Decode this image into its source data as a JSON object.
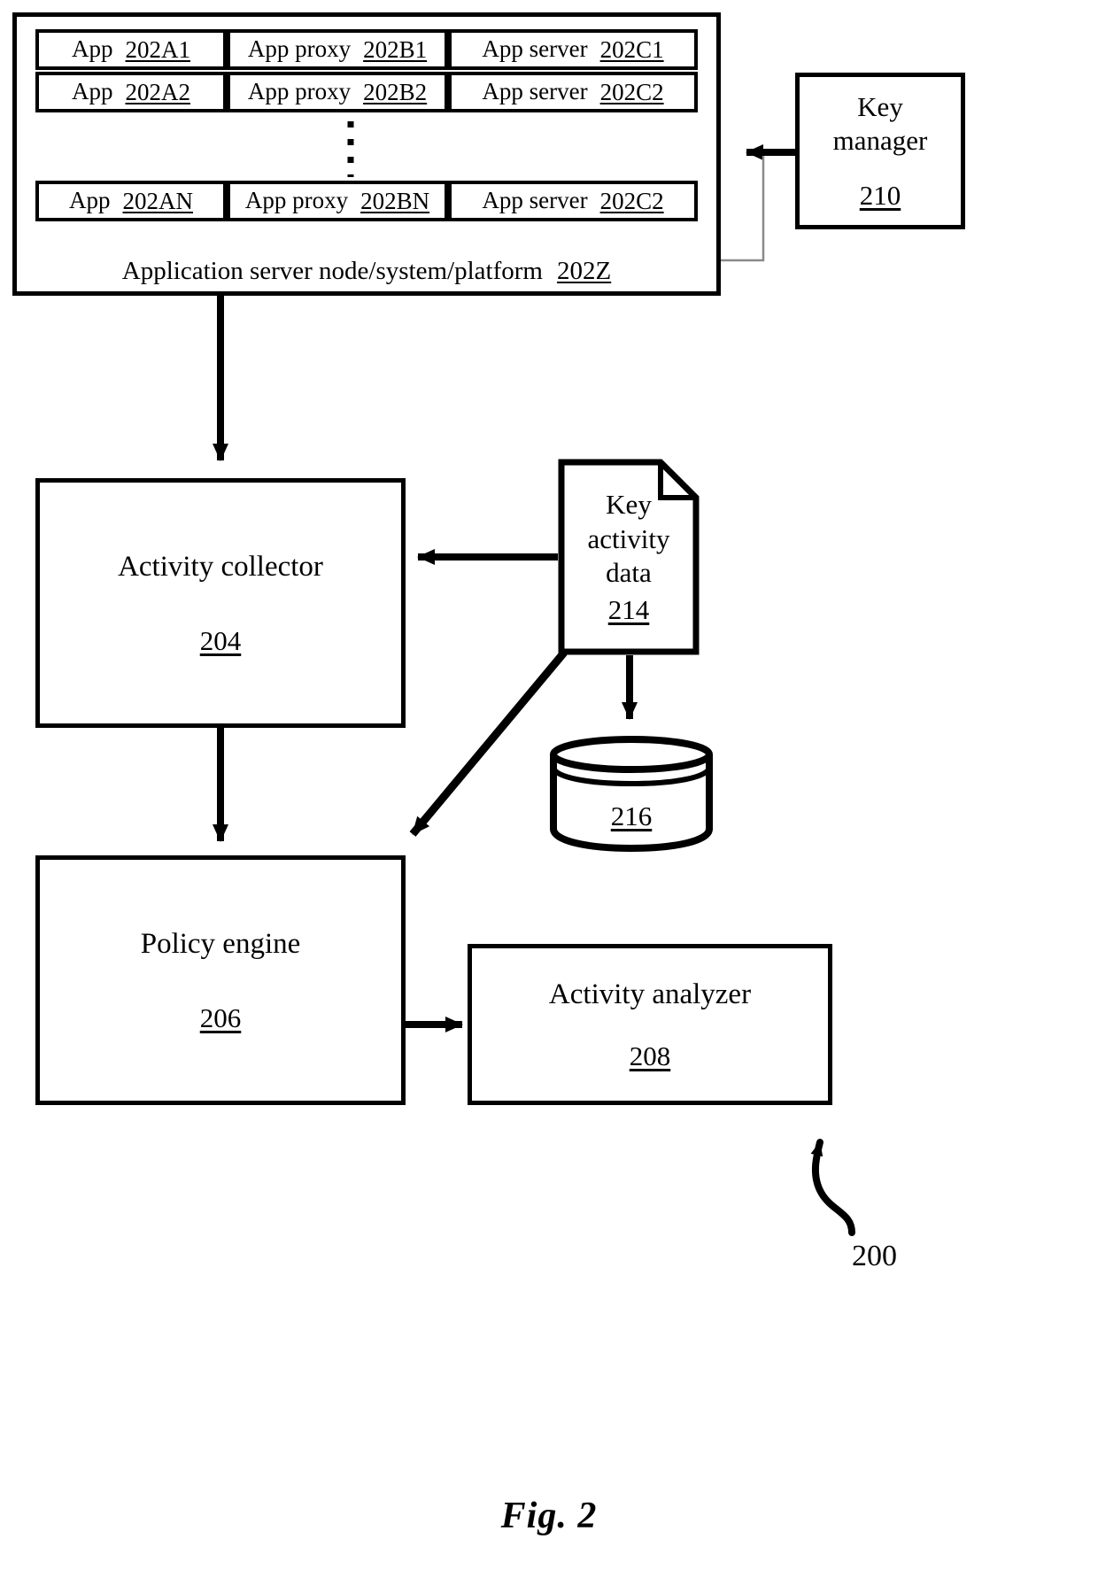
{
  "figure": {
    "caption": "Fig. 2",
    "system_ref": "200"
  },
  "app_server_node": {
    "caption_label": "Application server node/system/platform",
    "caption_ref": "202Z",
    "rows": [
      {
        "app": {
          "label": "App",
          "ref": "202A1"
        },
        "proxy": {
          "label": "App proxy",
          "ref": "202B1"
        },
        "server": {
          "label": "App server",
          "ref": "202C1"
        }
      },
      {
        "app": {
          "label": "App",
          "ref": "202A2"
        },
        "proxy": {
          "label": "App proxy",
          "ref": "202B2"
        },
        "server": {
          "label": "App server",
          "ref": "202C2"
        }
      },
      {
        "app": {
          "label": "App",
          "ref": "202AN"
        },
        "proxy": {
          "label": "App proxy",
          "ref": "202BN"
        },
        "server": {
          "label": "App server",
          "ref": "202C2"
        }
      }
    ],
    "ellipsis": "vertical-dotted"
  },
  "key_manager": {
    "line1": "Key",
    "line2": "manager",
    "ref": "210"
  },
  "activity_collector": {
    "label": "Activity collector",
    "ref": "204"
  },
  "policy_engine": {
    "label": "Policy engine",
    "ref": "206"
  },
  "activity_analyzer": {
    "label": "Activity analyzer",
    "ref": "208"
  },
  "key_activity_data": {
    "line1": "Key",
    "line2": "activity",
    "line3": "data",
    "ref": "214"
  },
  "key_store": {
    "ref": "216"
  },
  "colors": {
    "stroke": "#000000",
    "fill": "#ffffff",
    "thin_stroke": "#6b6b6b"
  }
}
